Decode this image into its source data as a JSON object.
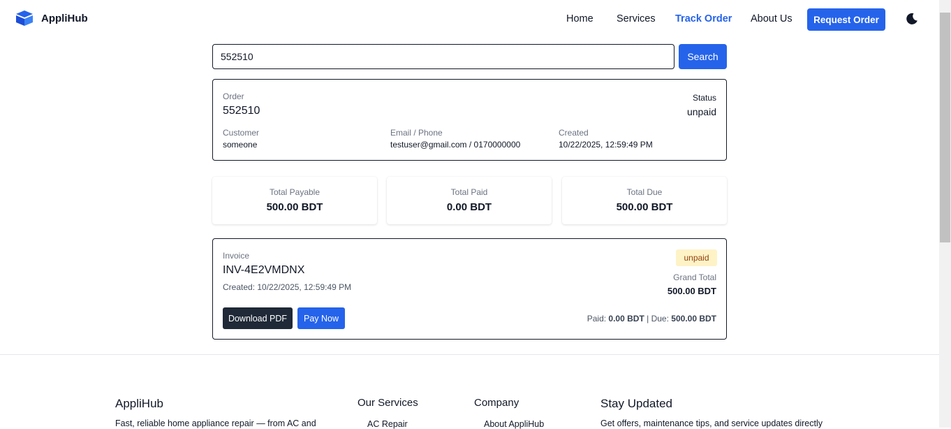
{
  "header": {
    "brand": "AppliHub",
    "nav": [
      "Home",
      "Services",
      "Track Order",
      "About Us"
    ],
    "active_nav": "Track Order",
    "request_button": "Request Order",
    "theme_icon": "moon-icon",
    "logo_icon": "box-icon"
  },
  "search": {
    "value": "552510",
    "button": "Search"
  },
  "order": {
    "order_label": "Order",
    "order_id": "552510",
    "status_label": "Status",
    "status_value": "unpaid",
    "customer_label": "Customer",
    "customer_value": "someone",
    "contact_label": "Email / Phone",
    "contact_value": "testuser@gmail.com / 0170000000",
    "created_label": "Created",
    "created_value": "10/22/2025, 12:59:49 PM"
  },
  "stats": [
    {
      "label": "Total Payable",
      "value": "500.00 BDT"
    },
    {
      "label": "Total Paid",
      "value": "0.00 BDT"
    },
    {
      "label": "Total Due",
      "value": "500.00 BDT"
    }
  ],
  "invoice": {
    "label": "Invoice",
    "id": "INV-4E2VMDNX",
    "created": "Created: 10/22/2025, 12:59:49 PM",
    "status_badge": "unpaid",
    "grand_total_label": "Grand Total",
    "grand_total": "500.00 BDT",
    "download_button": "Download PDF",
    "pay_button": "Pay Now",
    "paid_label": "Paid:",
    "paid_value": "0.00 BDT",
    "separator": "|",
    "due_label": "Due:",
    "due_value": "500.00 BDT"
  },
  "footer": {
    "brand": "AppliHub",
    "description": "Fast, reliable home appliance repair — from AC and",
    "services_title": "Our Services",
    "services_first": "AC Repair",
    "company_title": "Company",
    "company_first": "About AppliHub",
    "newsletter_title": "Stay Updated",
    "newsletter_text": "Get offers, maintenance tips, and service updates directly"
  },
  "colors": {
    "accent": "#2563eb",
    "dark_button": "#1f2937",
    "badge_bg": "#fef3c7",
    "badge_text": "#92400e"
  }
}
